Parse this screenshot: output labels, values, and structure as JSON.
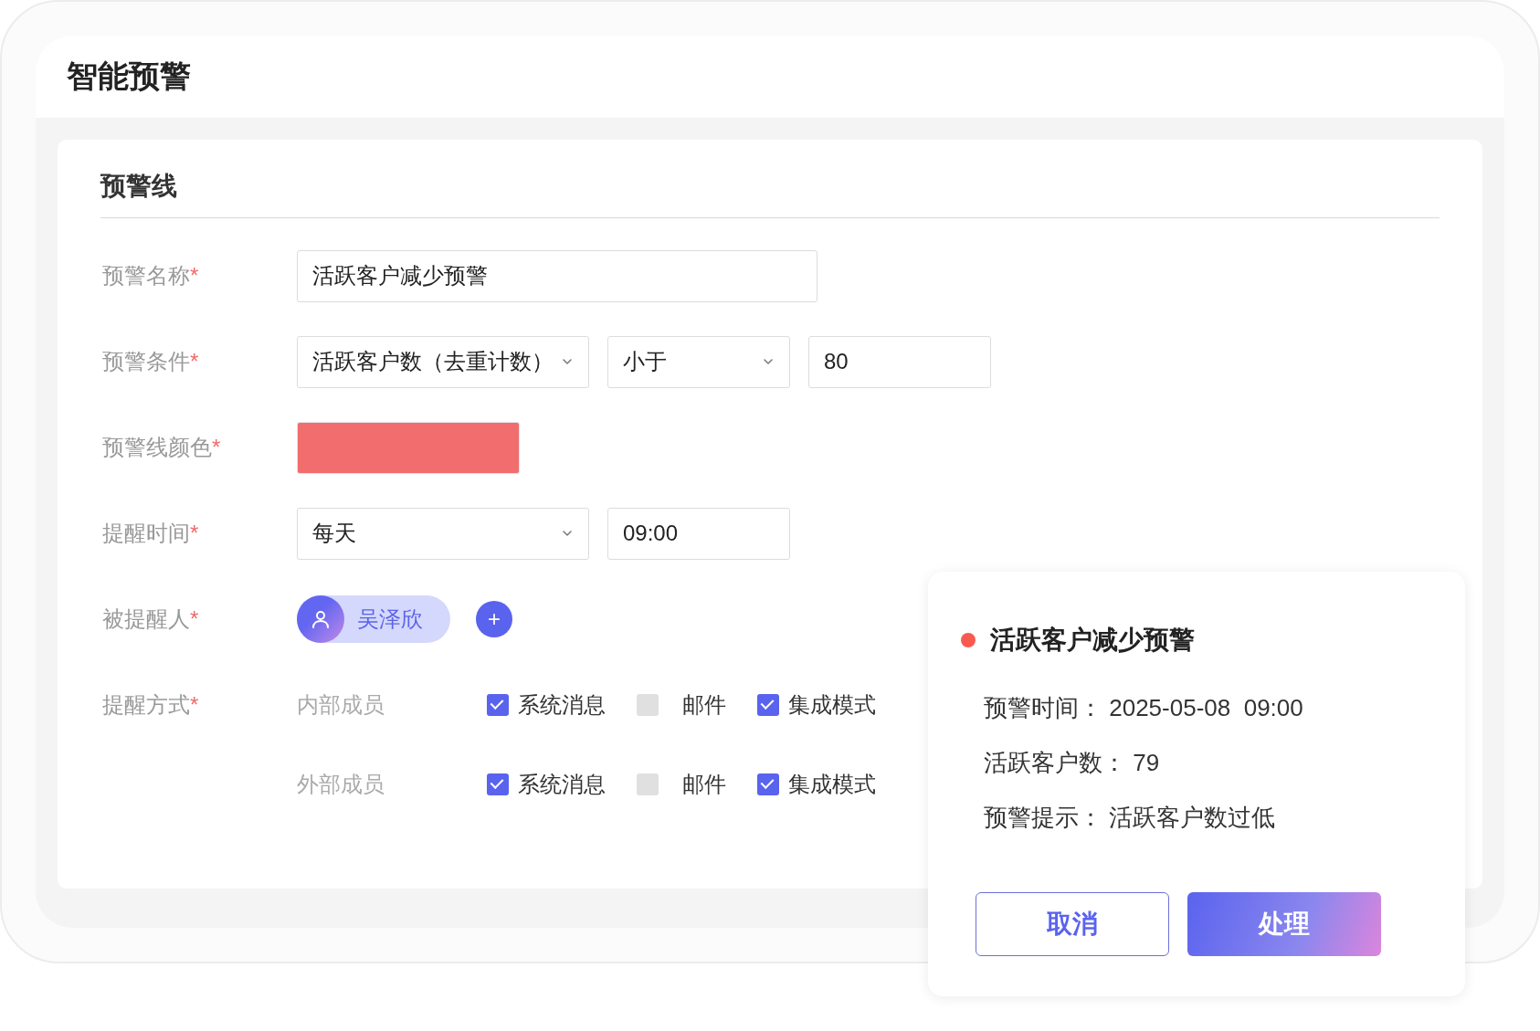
{
  "page": {
    "title": "智能预警"
  },
  "section": {
    "title": "预警线"
  },
  "rows": [
    {
      "kind": "fields",
      "label": "预警名称",
      "required": "*",
      "fields": [
        {
          "kind": "text",
          "value": "活跃客户减少预警"
        }
      ]
    },
    {
      "kind": "fields",
      "label": "预警条件",
      "required": "*",
      "fields": [
        {
          "kind": "select",
          "value": "活跃客户数（去重计数）"
        },
        {
          "kind": "select",
          "value": "小于"
        },
        {
          "kind": "text",
          "value": "80"
        }
      ]
    },
    {
      "kind": "color",
      "label": "预警线颜色",
      "required": "*",
      "color": "#f26d6d"
    },
    {
      "kind": "fields",
      "label": "提醒时间",
      "required": "*",
      "fields": [
        {
          "kind": "select",
          "value": "每天"
        },
        {
          "kind": "text",
          "value": "09:00"
        }
      ]
    },
    {
      "kind": "people",
      "label": "被提醒人",
      "required": "*",
      "people": [
        {
          "name": "吴泽欣"
        }
      ],
      "add_button": "+"
    },
    {
      "kind": "channels",
      "label": "提醒方式",
      "required": "*",
      "groups": [
        {
          "name": "内部成员",
          "options": [
            {
              "label": "系统消息",
              "checked": true
            },
            {
              "label": "邮件",
              "checked": false
            },
            {
              "label": "集成模式",
              "checked": true
            }
          ]
        },
        {
          "name": "外部成员",
          "options": [
            {
              "label": "系统消息",
              "checked": true
            },
            {
              "label": "邮件",
              "checked": false
            },
            {
              "label": "集成模式",
              "checked": true
            }
          ]
        }
      ]
    }
  ],
  "popup": {
    "color": "#f85a4f",
    "title": "活跃客户减少预警",
    "lines": [
      {
        "label": "预警时间：",
        "value": "2025-05-08  09:00"
      },
      {
        "label": "活跃客户数：",
        "value": "79"
      },
      {
        "label": "预警提示：",
        "value": "活跃客户数过低"
      }
    ],
    "buttons": [
      {
        "label": "取消",
        "kind": "secondary"
      },
      {
        "label": "处理",
        "kind": "primary"
      }
    ]
  }
}
